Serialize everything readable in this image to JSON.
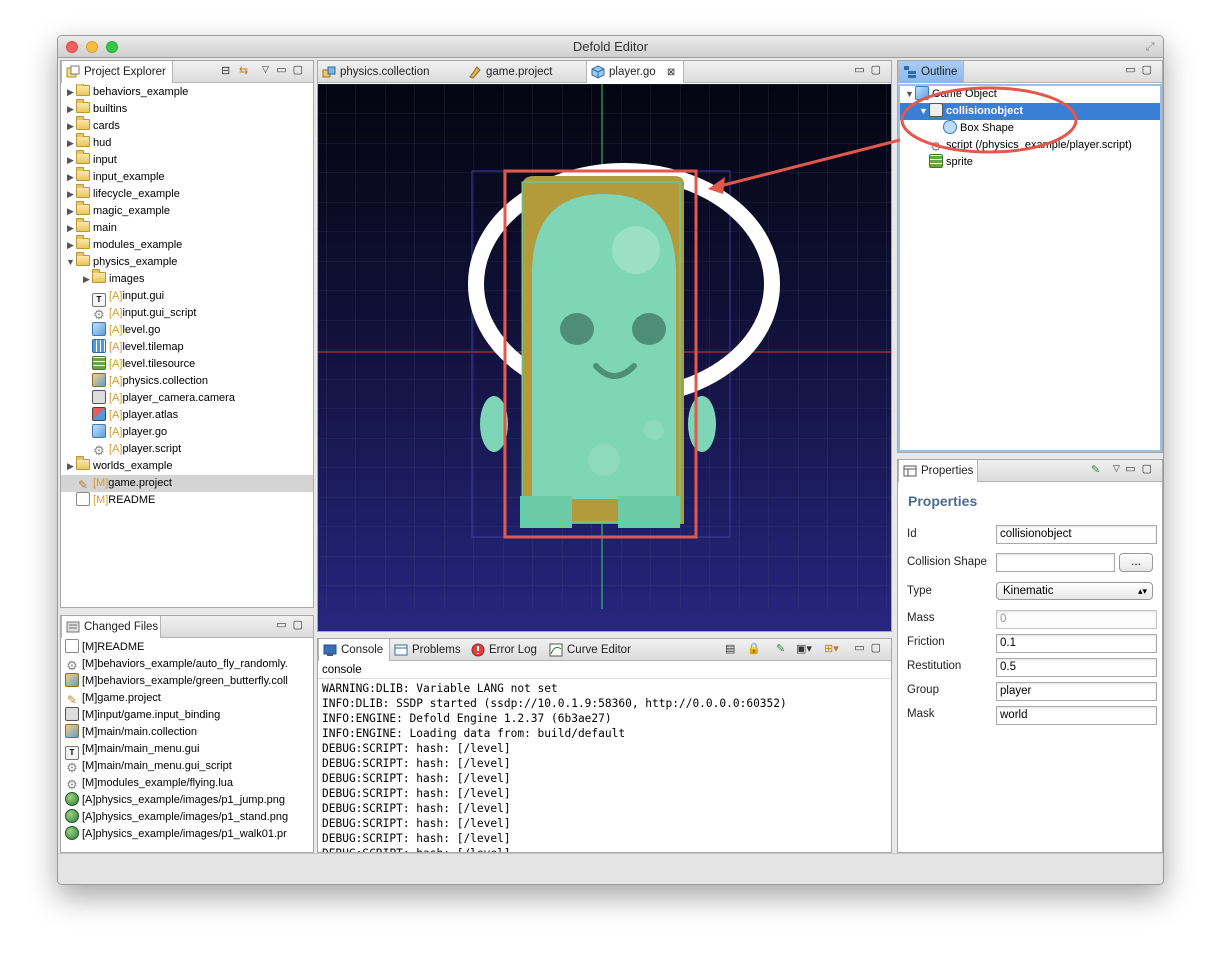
{
  "window": {
    "title": "Defold Editor"
  },
  "project_explorer": {
    "tab_label": "Project Explorer",
    "items": [
      {
        "label": "behaviors_example",
        "depth": 0,
        "kind": "folder",
        "expanded": false
      },
      {
        "label": "builtins",
        "depth": 0,
        "kind": "folder",
        "expanded": false
      },
      {
        "label": "cards",
        "depth": 0,
        "kind": "folder",
        "expanded": false
      },
      {
        "label": "hud",
        "depth": 0,
        "kind": "folder",
        "expanded": false
      },
      {
        "label": "input",
        "depth": 0,
        "kind": "folder",
        "expanded": false
      },
      {
        "label": "input_example",
        "depth": 0,
        "kind": "folder",
        "expanded": false
      },
      {
        "label": "lifecycle_example",
        "depth": 0,
        "kind": "folder",
        "expanded": false
      },
      {
        "label": "magic_example",
        "depth": 0,
        "kind": "folder",
        "expanded": false
      },
      {
        "label": "main",
        "depth": 0,
        "kind": "folder",
        "expanded": false
      },
      {
        "label": "modules_example",
        "depth": 0,
        "kind": "folder",
        "expanded": false
      },
      {
        "label": "physics_example",
        "depth": 0,
        "kind": "folder",
        "expanded": true
      },
      {
        "label": "images",
        "depth": 1,
        "kind": "folder",
        "expanded": false
      },
      {
        "status": "[A]",
        "label": "input.gui",
        "depth": 1,
        "kind": "gui"
      },
      {
        "status": "[A]",
        "label": "input.gui_script",
        "depth": 1,
        "kind": "gear"
      },
      {
        "status": "[A]",
        "label": "level.go",
        "depth": 1,
        "kind": "gocube"
      },
      {
        "status": "[A]",
        "label": "level.tilemap",
        "depth": 1,
        "kind": "tilemap"
      },
      {
        "status": "[A]",
        "label": "level.tilesource",
        "depth": 1,
        "kind": "tilesrc"
      },
      {
        "status": "[A]",
        "label": "physics.collection",
        "depth": 1,
        "kind": "coll"
      },
      {
        "status": "[A]",
        "label": "player_camera.camera",
        "depth": 1,
        "kind": "camera"
      },
      {
        "status": "[A]",
        "label": "player.atlas",
        "depth": 1,
        "kind": "atlas"
      },
      {
        "status": "[A]",
        "label": "player.go",
        "depth": 1,
        "kind": "gocube"
      },
      {
        "status": "[A]",
        "label": "player.script",
        "depth": 1,
        "kind": "gear"
      },
      {
        "label": "worlds_example",
        "depth": 0,
        "kind": "folder",
        "expanded": false
      },
      {
        "status": "[M]",
        "label": "game.project",
        "depth": 0,
        "kind": "pencil",
        "selected": true
      },
      {
        "status": "[M]",
        "label": "README",
        "depth": 0,
        "kind": "doc"
      }
    ]
  },
  "changed_files": {
    "tab_label": "Changed Files",
    "items": [
      {
        "label": "[M]README",
        "kind": "doc"
      },
      {
        "label": "[M]behaviors_example/auto_fly_randomly.",
        "kind": "gear"
      },
      {
        "label": "[M]behaviors_example/green_butterfly.coll",
        "kind": "coll"
      },
      {
        "label": "[M]game.project",
        "kind": "pencil"
      },
      {
        "label": "[M]input/game.input_binding",
        "kind": "camera"
      },
      {
        "label": "[M]main/main.collection",
        "kind": "coll"
      },
      {
        "label": "[M]main/main_menu.gui",
        "kind": "gui"
      },
      {
        "label": "[M]main/main_menu.gui_script",
        "kind": "gear"
      },
      {
        "label": "[M]modules_example/flying.lua",
        "kind": "gear"
      },
      {
        "label": "[A]physics_example/images/p1_jump.png",
        "kind": "globe"
      },
      {
        "label": "[A]physics_example/images/p1_stand.png",
        "kind": "globe"
      },
      {
        "label": "[A]physics_example/images/p1_walk01.pr",
        "kind": "globe"
      }
    ]
  },
  "editor": {
    "tabs": [
      {
        "label": "physics.collection",
        "active": false
      },
      {
        "label": "game.project",
        "active": false
      },
      {
        "label": "player.go",
        "active": true
      }
    ],
    "close_glyph": "⊠"
  },
  "bottom": {
    "tabs": [
      {
        "label": "Console",
        "active": true
      },
      {
        "label": "Problems",
        "active": false
      },
      {
        "label": "Error Log",
        "active": false
      },
      {
        "label": "Curve Editor",
        "active": false
      }
    ],
    "console_header": "console",
    "console_lines": [
      "WARNING:DLIB: Variable LANG not set",
      "INFO:DLIB: SSDP started (ssdp://10.0.1.9:58360, http://0.0.0.0:60352)",
      "INFO:ENGINE: Defold Engine 1.2.37 (6b3ae27)",
      "INFO:ENGINE: Loading data from: build/default",
      "DEBUG:SCRIPT: hash: [/level]",
      "DEBUG:SCRIPT: hash: [/level]",
      "DEBUG:SCRIPT: hash: [/level]",
      "DEBUG:SCRIPT: hash: [/level]",
      "DEBUG:SCRIPT: hash: [/level]",
      "DEBUG:SCRIPT: hash: [/level]",
      "DEBUG:SCRIPT: hash: [/level]",
      "DEBUG:SCRIPT: hash: [/level]"
    ]
  },
  "outline": {
    "tab_label": "Outline",
    "items": [
      {
        "label": "Game Object",
        "depth": 0,
        "kind": "gocube",
        "expanded": true
      },
      {
        "label": "collisionobject",
        "depth": 1,
        "kind": "collision",
        "expanded": true,
        "selected": true
      },
      {
        "label": "Box Shape",
        "depth": 2,
        "kind": "shape"
      },
      {
        "label": "script (/physics_example/player.script)",
        "depth": 1,
        "kind": "gear"
      },
      {
        "label": "sprite",
        "depth": 1,
        "kind": "tilesrc"
      }
    ]
  },
  "properties": {
    "tab_label": "Properties",
    "title": "Properties",
    "fields": {
      "id": {
        "label": "Id",
        "value": "collisionobject"
      },
      "collision_shape": {
        "label": "Collision Shape",
        "value": "",
        "button": "..."
      },
      "type": {
        "label": "Type",
        "value": "Kinematic"
      },
      "mass": {
        "label": "Mass",
        "value": "0"
      },
      "friction": {
        "label": "Friction",
        "value": "0.1"
      },
      "restitution": {
        "label": "Restitution",
        "value": "0.5"
      },
      "group": {
        "label": "Group",
        "value": "player"
      },
      "mask": {
        "label": "Mask",
        "value": "world"
      }
    }
  },
  "colors": {
    "annotation": "#e4574c",
    "selection": "#3a7fd6",
    "viewport_top": "#050510",
    "viewport_bottom": "#262680",
    "character": "#7fd6b6"
  }
}
